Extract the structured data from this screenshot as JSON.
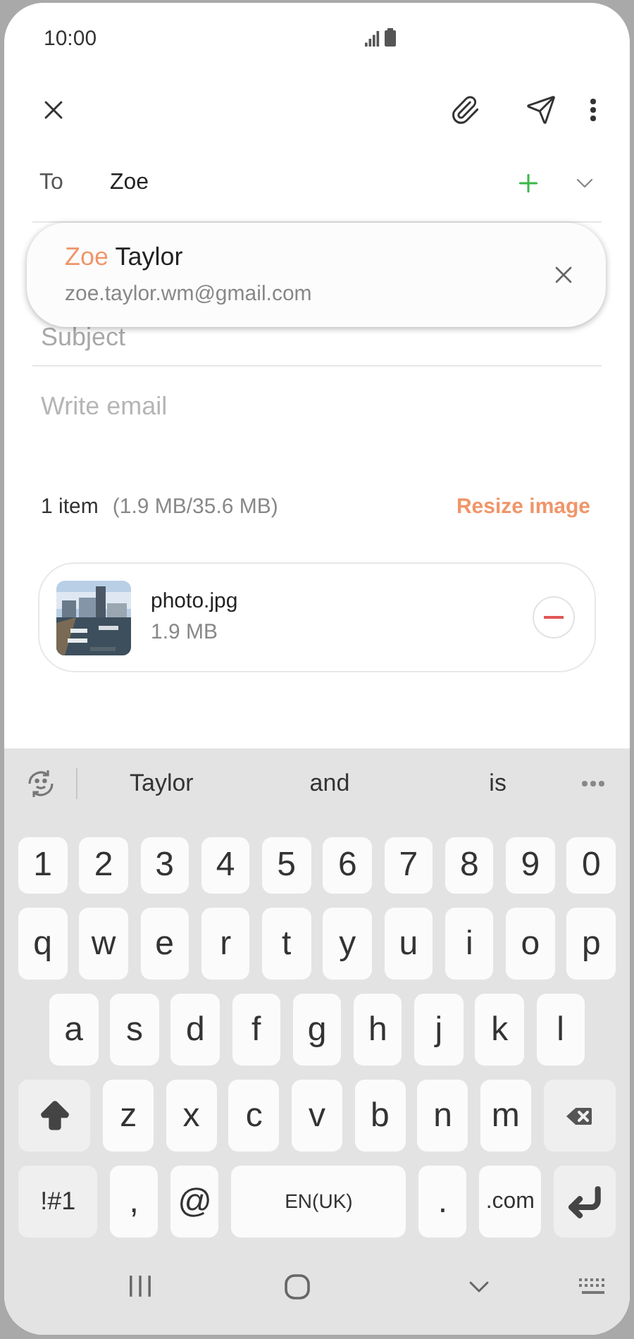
{
  "status_bar": {
    "time": "10:00"
  },
  "recipient": {
    "label": "To",
    "value": "Zoe"
  },
  "suggestion": {
    "name_match": "Zoe",
    "name_rest": "Taylor",
    "email": "zoe.taylor.wm@gmail.com"
  },
  "subject": {
    "placeholder": "Subject"
  },
  "body": {
    "placeholder": "Write email"
  },
  "attachments": {
    "count": "1 item",
    "size": "(1.9 MB/35.6 MB)",
    "action": "Resize image",
    "items": [
      {
        "kind": "picture",
        "name": "photo.jpg",
        "size": "1.9 MB"
      }
    ]
  },
  "keyboard": {
    "suggestions": [
      "Taylor",
      "and",
      "is"
    ],
    "key_rows": [
      {
        "keys": [
          {
            "kind": "num",
            "label": "1"
          },
          {
            "kind": "num",
            "label": "2"
          },
          {
            "kind": "num",
            "label": "3"
          },
          {
            "kind": "num",
            "label": "4"
          },
          {
            "kind": "num",
            "label": "5"
          },
          {
            "kind": "num",
            "label": "6"
          },
          {
            "kind": "num",
            "label": "7"
          },
          {
            "kind": "num",
            "label": "8"
          },
          {
            "kind": "num",
            "label": "9"
          },
          {
            "kind": "num",
            "label": "0"
          }
        ]
      },
      {
        "keys": [
          {
            "kind": "char",
            "label": "q"
          },
          {
            "kind": "char",
            "label": "w"
          },
          {
            "kind": "char",
            "label": "e"
          },
          {
            "kind": "char",
            "label": "r"
          },
          {
            "kind": "char",
            "label": "t"
          },
          {
            "kind": "char",
            "label": "y"
          },
          {
            "kind": "char",
            "label": "u"
          },
          {
            "kind": "char",
            "label": "i"
          },
          {
            "kind": "char",
            "label": "o"
          },
          {
            "kind": "char",
            "label": "p"
          }
        ]
      },
      {
        "keys": [
          {
            "kind": "char",
            "label": "a"
          },
          {
            "kind": "char",
            "label": "s"
          },
          {
            "kind": "char",
            "label": "d"
          },
          {
            "kind": "char",
            "label": "f"
          },
          {
            "kind": "char",
            "label": "g"
          },
          {
            "kind": "char",
            "label": "h"
          },
          {
            "kind": "char",
            "label": "j"
          },
          {
            "kind": "char",
            "label": "k"
          },
          {
            "kind": "char",
            "label": "l"
          }
        ]
      },
      {
        "keys": [
          {
            "kind": "shift"
          },
          {
            "kind": "char",
            "label": "z"
          },
          {
            "kind": "char",
            "label": "x"
          },
          {
            "kind": "char",
            "label": "c"
          },
          {
            "kind": "char",
            "label": "v"
          },
          {
            "kind": "char",
            "label": "b"
          },
          {
            "kind": "char",
            "label": "n"
          },
          {
            "kind": "char",
            "label": "m"
          },
          {
            "kind": "backspace"
          }
        ]
      },
      {
        "keys": [
          {
            "kind": "symbols",
            "label": "!#1"
          },
          {
            "kind": "char",
            "label": ","
          },
          {
            "kind": "char",
            "label": "@"
          },
          {
            "kind": "space",
            "label": "EN(UK)"
          },
          {
            "kind": "char",
            "label": "."
          },
          {
            "kind": "domain",
            "label": ".com"
          },
          {
            "kind": "enter"
          }
        ]
      }
    ]
  }
}
